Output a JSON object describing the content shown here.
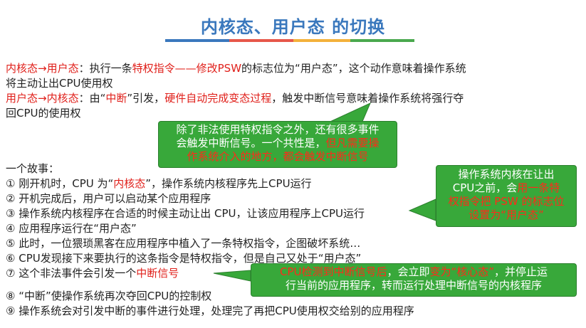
{
  "title": "内核态、用户态 的切换",
  "colors": {
    "title": "#3a78bd",
    "accent_red": "#e0201b",
    "callout_green": "#38a83a"
  },
  "para1": {
    "from": "内核态",
    "to": "用户态",
    "colon": "：执行一条",
    "privileged": "特权指令",
    "dash": "——",
    "modify": "修改PSW",
    "rest": "的标志位为“用户态”，这个动作意味着操作系统",
    "line2": "将主动让出CPU使用权"
  },
  "para2": {
    "from": "用户态",
    "to": "内核态",
    "colon": "：由“",
    "interrupt": "中断",
    "mid": "”引发，",
    "hw": "硬件自动完成变态过程",
    "rest": "，触发中断信号意味着操作系统将强行夺",
    "line2": "回CPU的使用权"
  },
  "arrow_symbol": "→",
  "callout1": {
    "line1": "除了非法使用特权指令之外，还有很多事件",
    "line2": "会触发中断信号。一个共性是，",
    "line2_hl": "但凡需要操",
    "line3_hl": "作系统介入的地方，都会触发中断信号"
  },
  "story": {
    "heading": "一个故事：",
    "item1_pre": "① 刚开机时，CPU 为“",
    "item1_hl": "内核态",
    "item1_post": "”，操作系统内核程序先上CPU运行",
    "item2": "② 开机完成后，用户可以启动某个应用程序",
    "item3": "③ 操作系统内核程序在合适的时候主动让出 CPU，让该应用程序上CPU运行",
    "item4": "④ 应用程序运行在“用户态”",
    "item5": "⑤ 此时，一位猥琐黑客在应用程序中植入了一条特权指令，企图破坏系统…",
    "item6": "⑥ CPU发现接下来要执行的这条指令是特权指令，但是自己又处于“用户态”",
    "item7_pre": "⑦ 这个非法事件会引发一个",
    "item7_hl": "中断信号",
    "item8": "⑧ “中断”使操作系统再次夺回CPU的控制权",
    "item9": "⑨ 操作系统会对引发中断的事件进行处理，处理完了再把CPU使用权交给别的应用程序"
  },
  "callout2": {
    "line1": "操作系统内核在让出",
    "line2_pre": "CPU之前，会",
    "line2_hl": "用一条特",
    "line3_hl": "权指令把 PSW 的标志位",
    "line4_hl": "设置为“用户态”"
  },
  "callout3": {
    "line1_hl": "CPU检测到中断信号后",
    "line1_mid": "，会立即",
    "line1_hl2": "变为“核心态”",
    "line1_post": "，并停止运",
    "line2": "行当前的应用程序，转而运行处理中断信号的内核程序"
  }
}
